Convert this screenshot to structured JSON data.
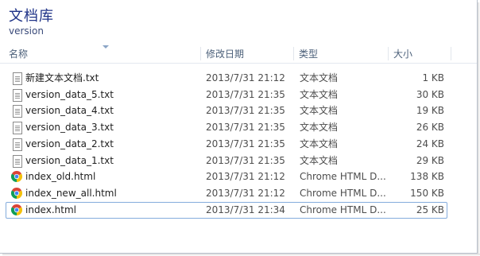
{
  "library": {
    "title": "文档库",
    "subtitle": "version"
  },
  "columns": {
    "name": "名称",
    "date": "修改日期",
    "type": "类型",
    "size": "大小"
  },
  "files": [
    {
      "name": "新建文本文档.txt",
      "date": "2013/7/31 21:12",
      "type": "文本文档",
      "size": "1 KB",
      "icon": "text-file-icon"
    },
    {
      "name": "version_data_5.txt",
      "date": "2013/7/31 21:35",
      "type": "文本文档",
      "size": "30 KB",
      "icon": "text-file-icon"
    },
    {
      "name": "version_data_4.txt",
      "date": "2013/7/31 21:35",
      "type": "文本文档",
      "size": "19 KB",
      "icon": "text-file-icon"
    },
    {
      "name": "version_data_3.txt",
      "date": "2013/7/31 21:35",
      "type": "文本文档",
      "size": "26 KB",
      "icon": "text-file-icon"
    },
    {
      "name": "version_data_2.txt",
      "date": "2013/7/31 21:35",
      "type": "文本文档",
      "size": "24 KB",
      "icon": "text-file-icon"
    },
    {
      "name": "version_data_1.txt",
      "date": "2013/7/31 21:35",
      "type": "文本文档",
      "size": "29 KB",
      "icon": "text-file-icon"
    },
    {
      "name": "index_old.html",
      "date": "2013/7/31 21:12",
      "type": "Chrome HTML D...",
      "size": "138 KB",
      "icon": "chrome-icon"
    },
    {
      "name": "index_new_all.html",
      "date": "2013/7/31 21:12",
      "type": "Chrome HTML D...",
      "size": "150 KB",
      "icon": "chrome-icon"
    },
    {
      "name": "index.html",
      "date": "2013/7/31 21:34",
      "type": "Chrome HTML D...",
      "size": "25 KB",
      "icon": "chrome-icon",
      "selected": true
    }
  ]
}
